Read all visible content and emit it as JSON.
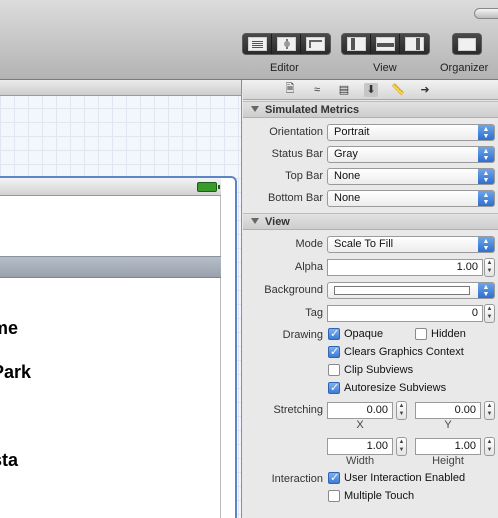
{
  "toolbar": {
    "editor_label": "Editor",
    "view_label": "View",
    "organizer_label": "Organizer",
    "editor_buttons": [
      "standard-editor-icon",
      "assistant-editor-icon",
      "version-editor-icon"
    ],
    "view_buttons": [
      "navigator-toggle-icon",
      "debug-area-toggle-icon",
      "utilities-toggle-icon"
    ],
    "organizer_icon": "organizer-icon"
  },
  "canvas": {
    "cell_texts": [
      "me",
      "Park",
      "sta"
    ]
  },
  "inspector": {
    "tabs": [
      {
        "icon": "file-inspector-icon",
        "glyph": "🗎"
      },
      {
        "icon": "quick-help-icon",
        "glyph": "≈"
      },
      {
        "icon": "identity-inspector-icon",
        "glyph": "▤"
      },
      {
        "icon": "attributes-inspector-icon",
        "glyph": "⬇"
      },
      {
        "icon": "size-inspector-icon",
        "glyph": "📏"
      },
      {
        "icon": "connections-inspector-icon",
        "glyph": "➜"
      }
    ],
    "simulated_metrics": {
      "title": "Simulated Metrics",
      "orientation_label": "Orientation",
      "orientation_value": "Portrait",
      "status_bar_label": "Status Bar",
      "status_bar_value": "Gray",
      "top_bar_label": "Top Bar",
      "top_bar_value": "None",
      "bottom_bar_label": "Bottom Bar",
      "bottom_bar_value": "None"
    },
    "view": {
      "title": "View",
      "mode_label": "Mode",
      "mode_value": "Scale To Fill",
      "alpha_label": "Alpha",
      "alpha_value": "1.00",
      "background_label": "Background",
      "tag_label": "Tag",
      "tag_value": "0",
      "drawing_label": "Drawing",
      "opaque_label": "Opaque",
      "opaque_checked": true,
      "hidden_label": "Hidden",
      "hidden_checked": false,
      "clears_label": "Clears Graphics Context",
      "clears_checked": true,
      "clip_label": "Clip Subviews",
      "clip_checked": false,
      "autoresize_label": "Autoresize Subviews",
      "autoresize_checked": true,
      "stretching_label": "Stretching",
      "stretch_x": "0.00",
      "stretch_y": "0.00",
      "x_label": "X",
      "y_label": "Y",
      "stretch_width": "1.00",
      "stretch_height": "1.00",
      "width_label": "Width",
      "height_label": "Height",
      "interaction_label": "Interaction",
      "user_interaction_label": "User Interaction Enabled",
      "user_interaction_checked": true,
      "multiple_touch_label": "Multiple Touch",
      "multiple_touch_checked": false
    }
  }
}
